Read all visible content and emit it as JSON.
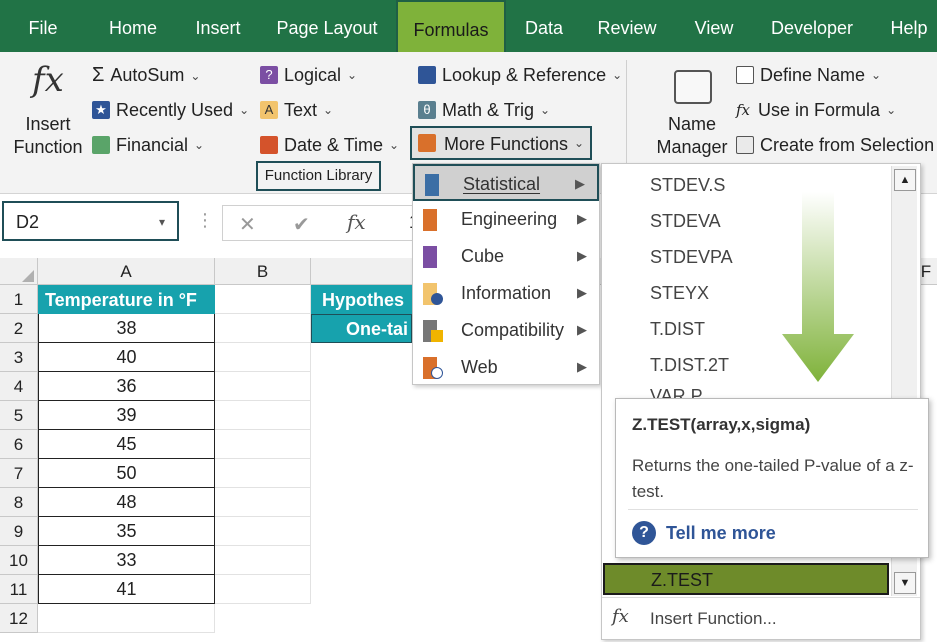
{
  "tabs": [
    "File",
    "Home",
    "Insert",
    "Page Layout",
    "Formulas",
    "Data",
    "Review",
    "View",
    "Developer",
    "Help"
  ],
  "active_tab": "Formulas",
  "ribbon": {
    "insert_function": [
      "Insert",
      "Function"
    ],
    "autosum": "AutoSum",
    "recently_used": "Recently Used",
    "financial": "Financial",
    "logical": "Logical",
    "text": "Text",
    "date_time": "Date & Time",
    "lookup_reference": "Lookup & Reference",
    "math_trig": "Math & Trig",
    "more_functions": "More Functions",
    "group_label": "Function Library",
    "name_manager": [
      "Name",
      "Manager"
    ],
    "define_name": "Define Name",
    "use_in_formula": "Use in Formula",
    "create_from_selection": "Create from Selection"
  },
  "namebox": {
    "value": "D2"
  },
  "formula_bar": {
    "cancel": "✕",
    "enter": "✔",
    "fx": "fx",
    "partial_value": "1"
  },
  "grid": {
    "columns": [
      "A",
      "B",
      "F"
    ],
    "rows": [
      "1",
      "2",
      "3",
      "4",
      "5",
      "6",
      "7",
      "8",
      "9",
      "10",
      "11",
      "12"
    ],
    "a_header": "Temperature in °F",
    "a_values": [
      "38",
      "40",
      "36",
      "39",
      "45",
      "50",
      "48",
      "35",
      "33",
      "41"
    ],
    "d1_partial": "Hypothes",
    "d2_partial": "One-tai"
  },
  "more_functions_menu": [
    {
      "label": "Statistical",
      "icon": "statistical-icon"
    },
    {
      "label": "Engineering",
      "icon": "engineering-icon"
    },
    {
      "label": "Cube",
      "icon": "cube-icon"
    },
    {
      "label": "Information",
      "icon": "information-icon"
    },
    {
      "label": "Compatibility",
      "icon": "compatibility-icon"
    },
    {
      "label": "Web",
      "icon": "web-icon"
    }
  ],
  "statistical_list": [
    "STDEV.S",
    "STDEVA",
    "STDEVPA",
    "STEYX",
    "T.DIST",
    "T.DIST.2T",
    "VAR.P"
  ],
  "selected_function": "Z.TEST",
  "tooltip": {
    "signature": "Z.TEST(array,x,sigma)",
    "description": "Returns the one-tailed P-value of a z-test.",
    "help_link": "Tell me more"
  },
  "insert_function_item": "Insert Function...",
  "colors": {
    "ribbon_green": "#217346",
    "active_tab": "#7fb23a",
    "header_teal": "#17a2ad",
    "selected_fn": "#6e8b2a",
    "arrow": "#7fb23a"
  }
}
